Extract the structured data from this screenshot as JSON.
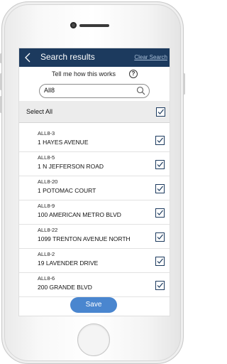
{
  "navbar": {
    "title": "Search results",
    "clear_label": "Clear Search"
  },
  "help": {
    "text": "Tell me how this works",
    "icon_glyph": "?"
  },
  "search": {
    "value": "All8",
    "icon": "search-icon"
  },
  "select_all": {
    "label": "Select All",
    "checked": true
  },
  "results": [
    {
      "code": "ALL8-3",
      "address": "1 HAYES AVENUE",
      "checked": true
    },
    {
      "code": "ALL8-5",
      "address": "1 N JEFFERSON ROAD",
      "checked": true
    },
    {
      "code": "ALL8-20",
      "address": "1 POTOMAC COURT",
      "checked": true
    },
    {
      "code": "ALL8-9",
      "address": "100 AMERICAN METRO BLVD",
      "checked": true
    },
    {
      "code": "ALL8-22",
      "address": "1099 TRENTON AVENUE NORTH",
      "checked": true
    },
    {
      "code": "ALL8-2",
      "address": "19 LAVENDER DRIVE",
      "checked": true
    },
    {
      "code": "ALL8-6",
      "address": "200 GRANDE BLVD",
      "checked": true
    }
  ],
  "save_label": "Save",
  "colors": {
    "navbar": "#1c3a5e",
    "accent": "#4a86cf",
    "checkmark": "#1c3a5e"
  }
}
